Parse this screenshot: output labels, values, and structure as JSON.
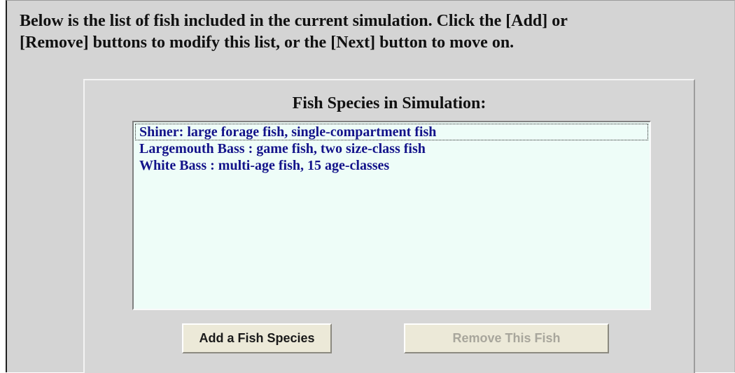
{
  "instructions": "Below is the list of fish included in the current simulation.  Click the [Add] or\n[Remove] buttons to modify this list, or the [Next] button to move on.",
  "panel": {
    "title": "Fish Species in Simulation:"
  },
  "fish_list": {
    "selected_index": 0,
    "items": [
      "Shiner: large forage fish, single-compartment fish",
      "Largemouth Bass : game fish, two size-class fish",
      "White Bass : multi-age fish, 15 age-classes"
    ]
  },
  "buttons": {
    "add_label": "Add a Fish Species",
    "remove_label": "Remove This Fish",
    "remove_enabled": false
  },
  "colors": {
    "background": "#d4d4d4",
    "list_background": "#eefdf8",
    "list_text": "#13138a",
    "button_face": "#ece9d8",
    "disabled_text": "#a8a69c"
  }
}
